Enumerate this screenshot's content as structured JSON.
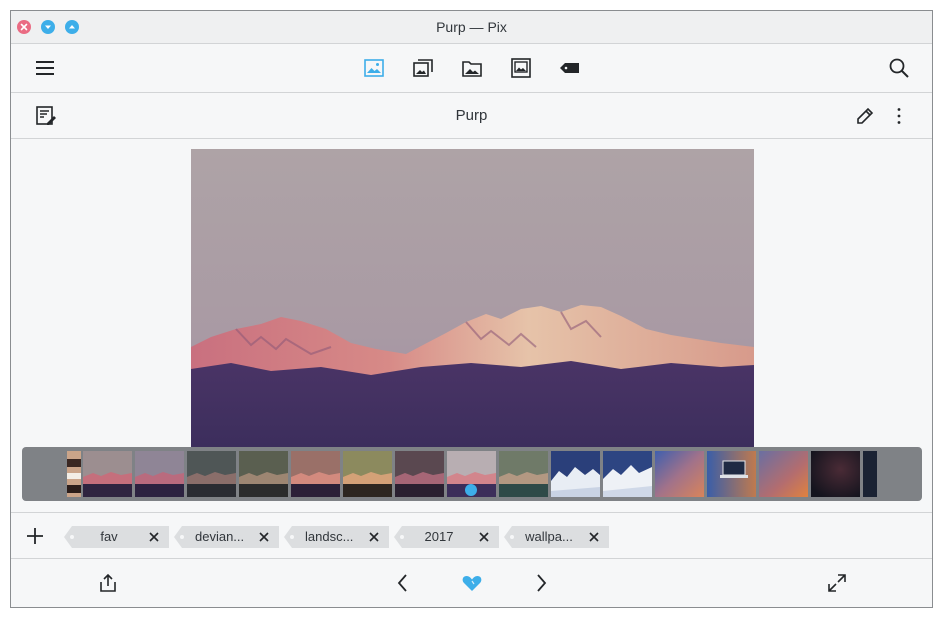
{
  "window": {
    "title": "Purp — Pix",
    "controls": [
      "close-icon",
      "minimize-icon",
      "maximize-icon"
    ]
  },
  "toolbar": {
    "menu_icon": "hamburger-menu-icon",
    "view_tabs": [
      {
        "icon": "image-icon",
        "active": true
      },
      {
        "icon": "collections-icon",
        "active": false
      },
      {
        "icon": "folder-icon",
        "active": false
      },
      {
        "icon": "gallery-icon",
        "active": false
      },
      {
        "icon": "tag-icon",
        "active": false
      }
    ],
    "search_icon": "search-icon"
  },
  "subbar": {
    "title": "Purp",
    "left_icon": "edit-document-icon",
    "right_icons": [
      "pencil-icon",
      "overflow-menu-icon"
    ]
  },
  "tags": {
    "add_icon": "plus-icon",
    "items": [
      {
        "label": "fav"
      },
      {
        "label": "devian..."
      },
      {
        "label": "landsc..."
      },
      {
        "label": "2017"
      },
      {
        "label": "wallpa..."
      }
    ]
  },
  "bottombar": {
    "icons": [
      "share-icon",
      "previous-icon",
      "favorite-heart-icon",
      "next-icon",
      "fullscreen-icon"
    ]
  },
  "colors": {
    "accent": "#3daee9",
    "close": "#ea6b83",
    "sky": "#ab9ea4",
    "foothills": "#3b2e5a",
    "strip": "#7f8286"
  }
}
